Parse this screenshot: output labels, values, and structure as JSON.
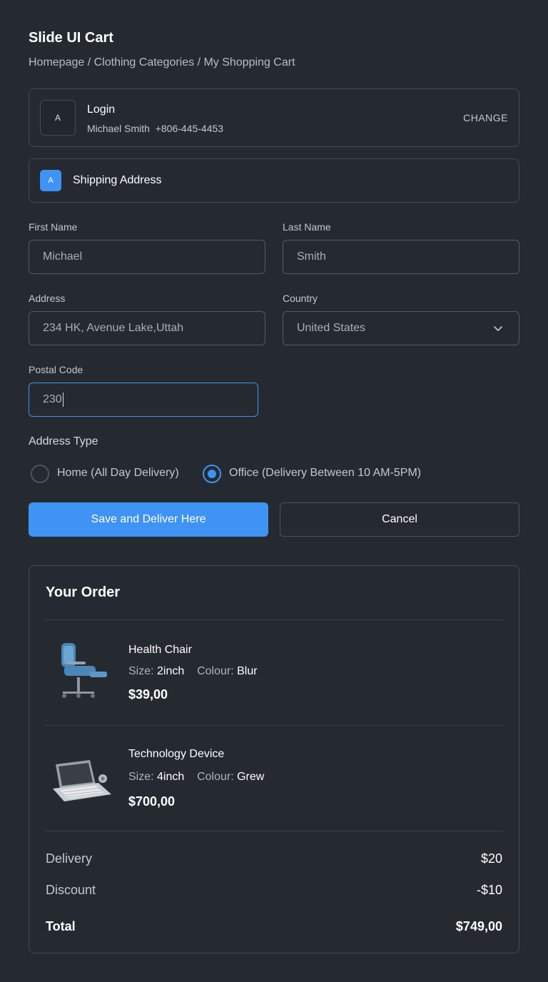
{
  "header": {
    "title": "Slide UI Cart",
    "breadcrumb": "Homepage / Clothing Categories / My Shopping Cart"
  },
  "login": {
    "avatar_letter": "A",
    "title": "Login",
    "user_name": "Michael Smith",
    "phone": "+806-445-4453",
    "change_label": "CHANGE"
  },
  "shipping": {
    "badge_letter": "A",
    "title": "Shipping Address"
  },
  "form": {
    "first_name_label": "First Name",
    "first_name_value": "Michael",
    "last_name_label": "Last Name",
    "last_name_value": "Smith",
    "address_label": "Address",
    "address_value": "234 HK, Avenue Lake,Uttah",
    "country_label": "Country",
    "country_value": "United States",
    "postal_label": "Postal Code",
    "postal_value": "230",
    "address_type_label": "Address Type",
    "options": [
      {
        "label": "Home (All Day Delivery)",
        "selected": false
      },
      {
        "label": "Office (Delivery Between 10 AM-5PM)",
        "selected": true
      }
    ],
    "save_label": "Save and Deliver Here",
    "cancel_label": "Cancel"
  },
  "order": {
    "title": "Your Order",
    "size_label": "Size:",
    "colour_label": "Colour:",
    "items": [
      {
        "name": "Health Chair",
        "size": "2inch",
        "colour": "Blur",
        "price": "$39,00",
        "icon": "chair-image"
      },
      {
        "name": "Technology Device",
        "size": "4inch",
        "colour": "Grew",
        "price": "$700,00",
        "icon": "keyboard-device-image"
      }
    ],
    "delivery_label": "Delivery",
    "delivery_value": "$20",
    "discount_label": "Discount",
    "discount_value": "-$10",
    "total_label": "Total",
    "total_value": "$749,00"
  },
  "colors": {
    "background": "#252a31",
    "accent": "#3f93f4",
    "border": "#434a54"
  }
}
